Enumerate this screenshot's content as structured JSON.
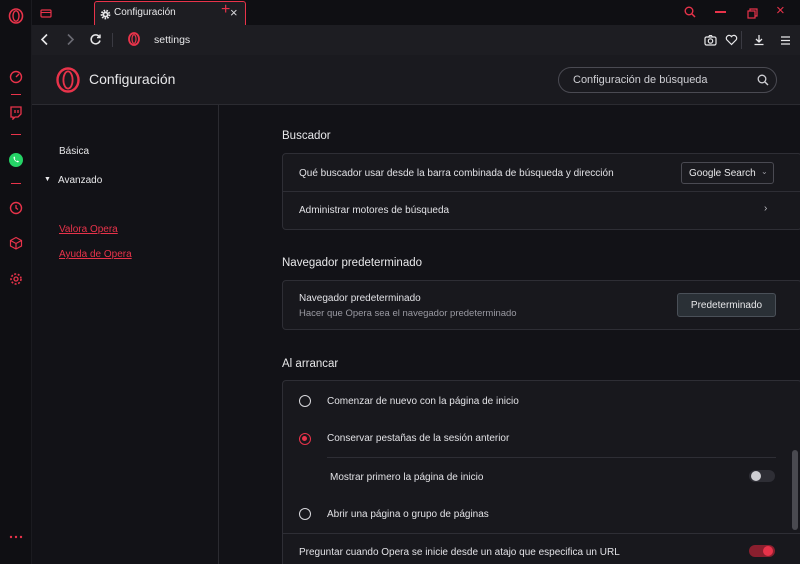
{
  "browser": {
    "tab_title": "Configuración",
    "address": "settings",
    "new_tab_symbol": "+"
  },
  "header": {
    "title": "Configuración",
    "search_placeholder": "Configuración de búsqueda"
  },
  "nav": {
    "basic": "Básica",
    "advanced": "Avanzado",
    "rate_opera": "Valora Opera",
    "help": "Ayuda de Opera"
  },
  "sections": {
    "search_engine": {
      "title": "Buscador",
      "row1_label": "Qué buscador usar desde la barra combinada de búsqueda y dirección",
      "row1_value": "Google Search",
      "row2_label": "Administrar motores de búsqueda"
    },
    "default_browser": {
      "title": "Navegador predeterminado",
      "label": "Navegador predeterminado",
      "sub": "Hacer que Opera sea el navegador predeterminado",
      "button": "Predeterminado"
    },
    "startup": {
      "title": "Al arrancar",
      "option1": "Comenzar de nuevo con la página de inicio",
      "option2": "Conservar pestañas de la sesión anterior",
      "option2_sub": "Mostrar primero la página de inicio",
      "option3": "Abrir una página o grupo de páginas",
      "ask_label": "Preguntar cuando Opera se inicie desde un atajo que especifica un URL"
    }
  },
  "colors": {
    "accent": "#e8334a",
    "background": "#121217",
    "card": "#18181d"
  }
}
